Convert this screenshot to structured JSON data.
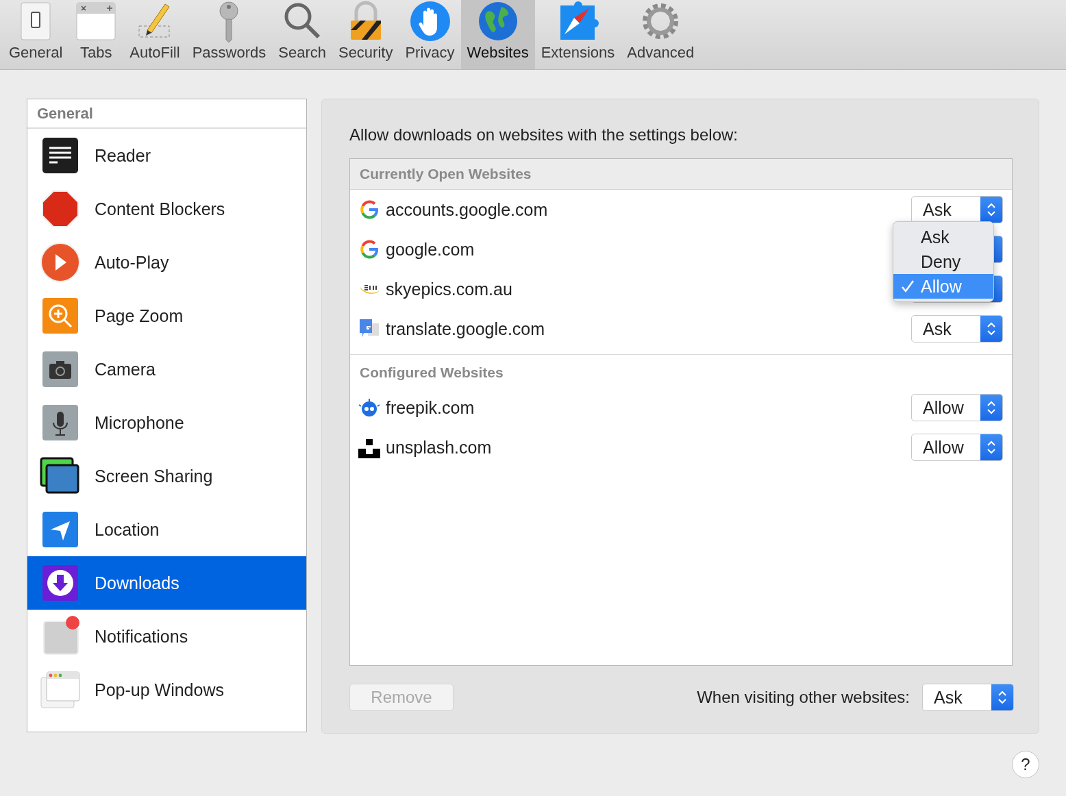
{
  "toolbar": [
    {
      "kind": "general",
      "label": "General",
      "selected": false
    },
    {
      "kind": "tabs",
      "label": "Tabs",
      "selected": false
    },
    {
      "kind": "autofill",
      "label": "AutoFill",
      "selected": false
    },
    {
      "kind": "passwords",
      "label": "Passwords",
      "selected": false
    },
    {
      "kind": "search",
      "label": "Search",
      "selected": false
    },
    {
      "kind": "security",
      "label": "Security",
      "selected": false
    },
    {
      "kind": "privacy",
      "label": "Privacy",
      "selected": false
    },
    {
      "kind": "websites",
      "label": "Websites",
      "selected": true
    },
    {
      "kind": "extensions",
      "label": "Extensions",
      "selected": false
    },
    {
      "kind": "advanced",
      "label": "Advanced",
      "selected": false
    }
  ],
  "sidebar": {
    "header": "General",
    "items": [
      {
        "kind": "reader",
        "label": "Reader",
        "selected": false
      },
      {
        "kind": "blockers",
        "label": "Content Blockers",
        "selected": false
      },
      {
        "kind": "autoplay",
        "label": "Auto-Play",
        "selected": false
      },
      {
        "kind": "zoom",
        "label": "Page Zoom",
        "selected": false
      },
      {
        "kind": "camera",
        "label": "Camera",
        "selected": false
      },
      {
        "kind": "microphone",
        "label": "Microphone",
        "selected": false
      },
      {
        "kind": "screen",
        "label": "Screen Sharing",
        "selected": false
      },
      {
        "kind": "location",
        "label": "Location",
        "selected": false
      },
      {
        "kind": "downloads",
        "label": "Downloads",
        "selected": true
      },
      {
        "kind": "notifications",
        "label": "Notifications",
        "selected": false
      },
      {
        "kind": "popup",
        "label": "Pop-up Windows",
        "selected": false
      }
    ]
  },
  "panel": {
    "title": "Allow downloads on websites with the settings below:",
    "sections": [
      {
        "header": "Currently Open Websites",
        "shaded": true,
        "rows": [
          {
            "kind": "google",
            "site": "accounts.google.com",
            "value": "Ask"
          },
          {
            "kind": "google",
            "site": "google.com"
          },
          {
            "kind": "sky",
            "site": "skyepics.com.au",
            "menu": [
              {
                "label": "Ask",
                "selected": false
              },
              {
                "label": "Deny",
                "selected": false
              },
              {
                "label": "Allow",
                "selected": true
              }
            ]
          },
          {
            "kind": "translate",
            "site": "translate.google.com",
            "value": "Ask"
          }
        ]
      },
      {
        "header": "Configured Websites",
        "shaded": false,
        "rows": [
          {
            "kind": "freepik",
            "site": "freepik.com",
            "value": "Allow"
          },
          {
            "kind": "unsplash",
            "site": "unsplash.com",
            "value": "Allow"
          }
        ]
      }
    ],
    "remove_button": {
      "label": "Remove",
      "disabled": true
    },
    "other_label": "When visiting other websites:",
    "other_value": "Ask"
  },
  "help_button": "?"
}
